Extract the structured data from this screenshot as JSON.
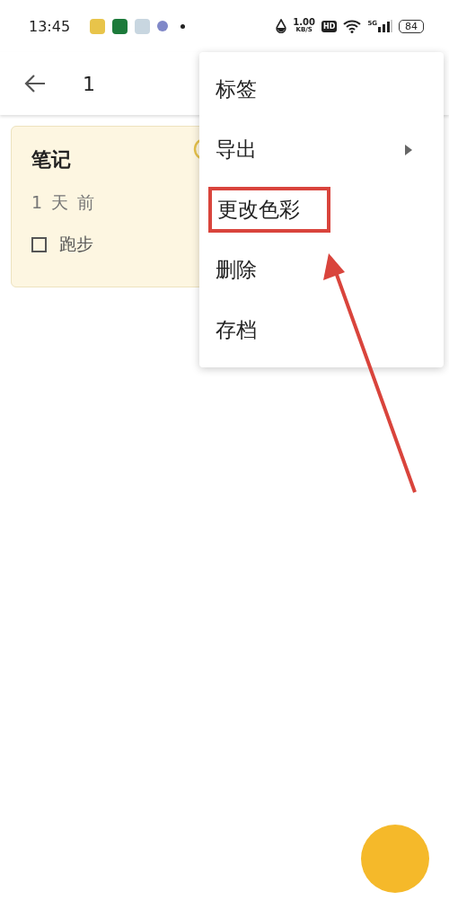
{
  "status_bar": {
    "time": "13:45",
    "speed": "1.00",
    "speed_unit": "KB/S",
    "hd": "HD",
    "network": "5G",
    "battery": "84"
  },
  "app_bar": {
    "title": "1"
  },
  "notes": [
    {
      "title": "笔记",
      "time": "1 天 前",
      "checklist": [
        {
          "text": "跑步",
          "checked": false
        }
      ],
      "selected": true,
      "color": "#fdf6e1"
    }
  ],
  "menu": {
    "items": [
      {
        "label": "标签",
        "submenu": false,
        "highlighted": false
      },
      {
        "label": "导出",
        "submenu": true,
        "highlighted": false
      },
      {
        "label": "更改色彩",
        "submenu": false,
        "highlighted": true
      },
      {
        "label": "删除",
        "submenu": false,
        "highlighted": false
      },
      {
        "label": "存档",
        "submenu": false,
        "highlighted": false
      }
    ]
  },
  "annotation": {
    "kind": "arrow"
  }
}
